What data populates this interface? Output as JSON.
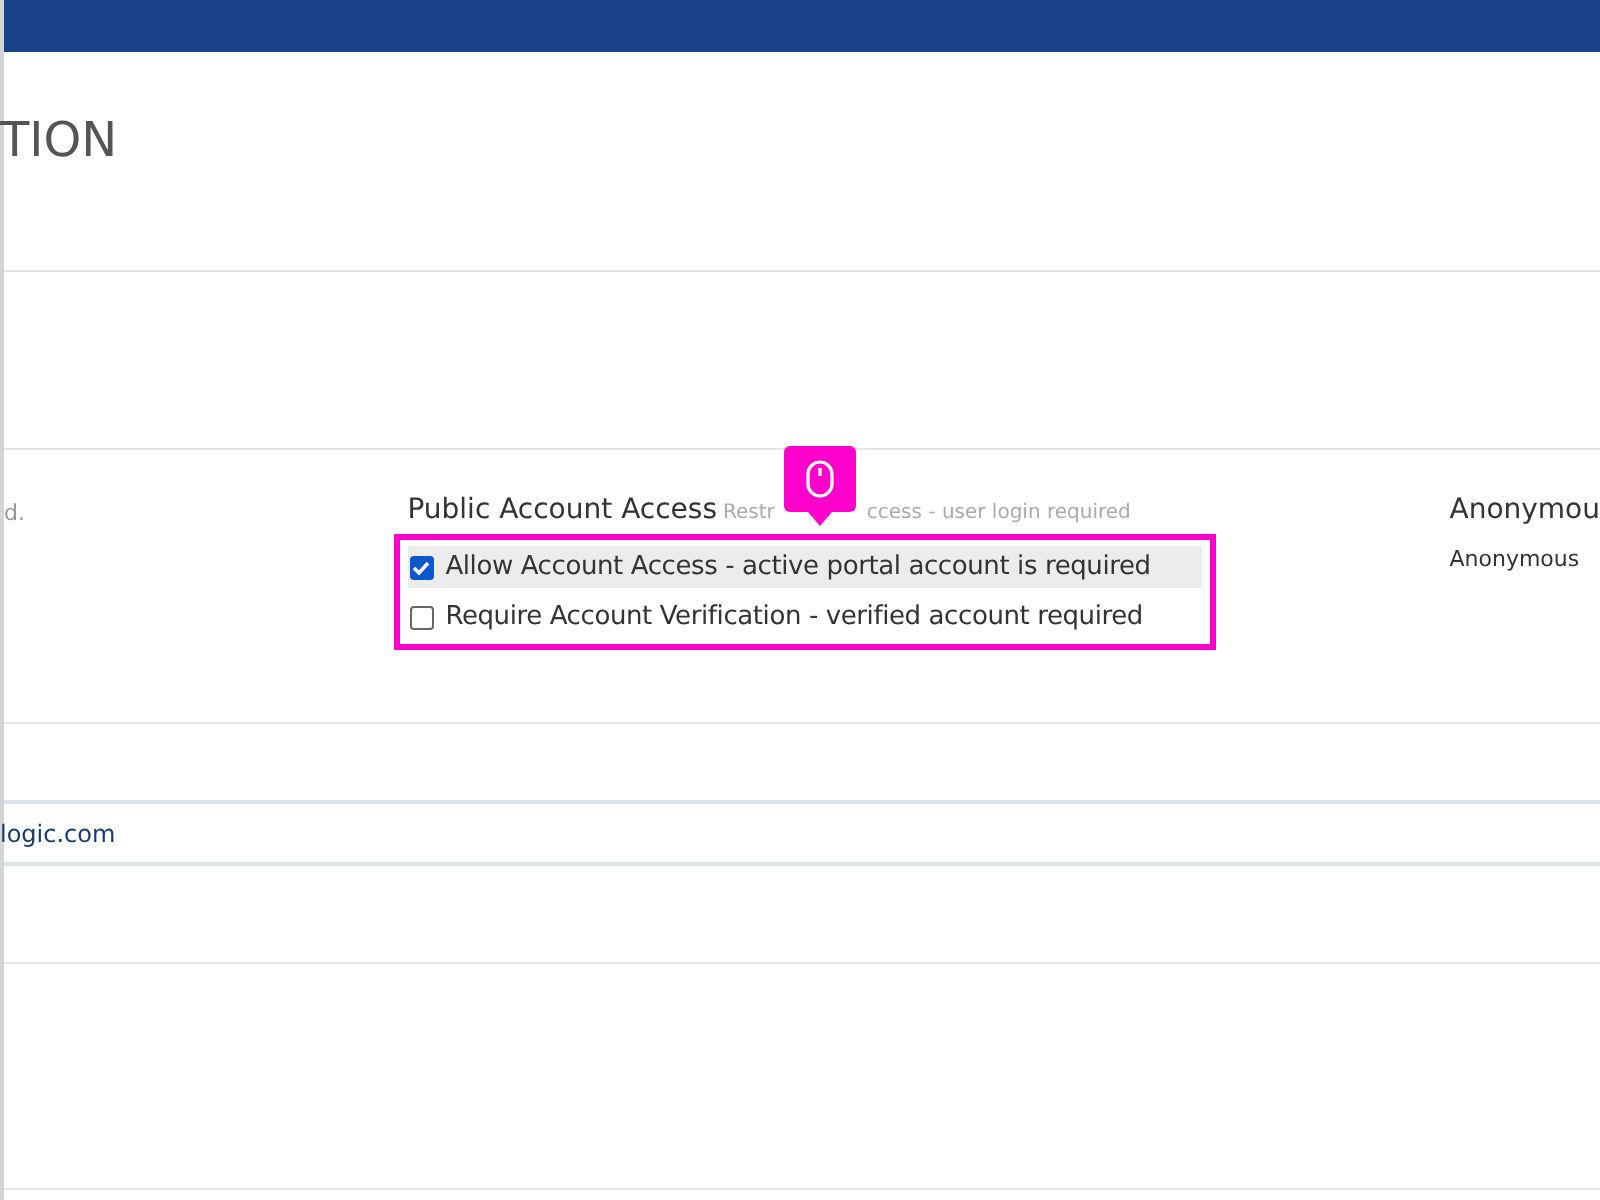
{
  "page_heading": "TION",
  "settings_row": {
    "left_note": "d.",
    "access_group": {
      "label": "Public Account Access",
      "hint_parts": [
        "Restr",
        "ccess - user login required"
      ],
      "options": [
        {
          "label": "Allow Account Access - active portal account is required",
          "checked": true,
          "highlighted": true
        },
        {
          "label": "Require Account Verification - verified account required",
          "checked": false,
          "highlighted": false
        }
      ]
    },
    "right_column": {
      "label": "Anonymou",
      "value": "Anonymous"
    }
  },
  "domain_row": {
    "value": "logic.com"
  }
}
